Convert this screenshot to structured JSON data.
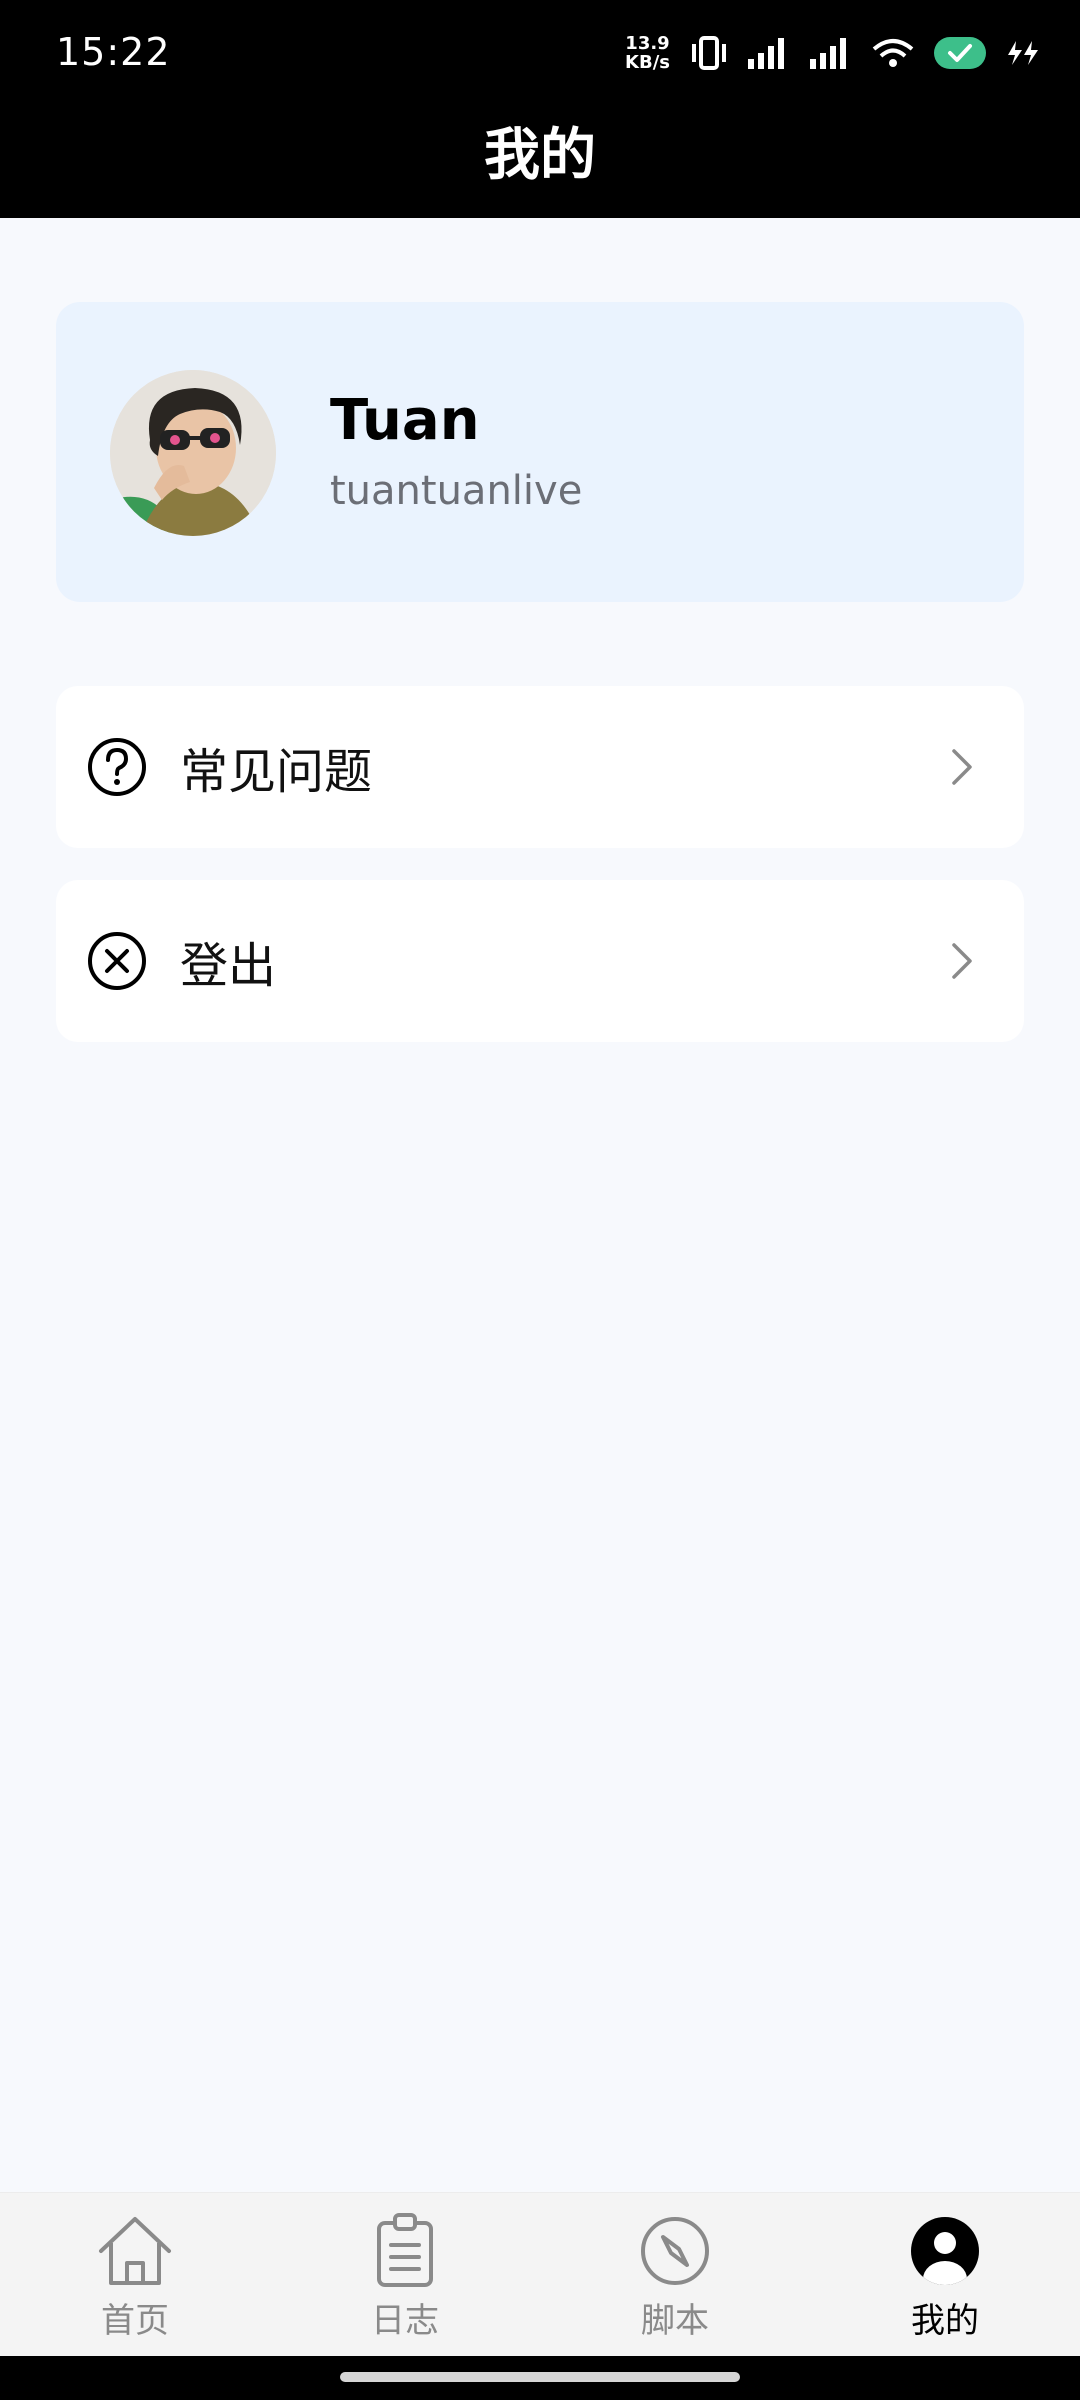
{
  "status_bar": {
    "time": "15:22",
    "net_speed_value": "13.9",
    "net_speed_unit": "KB/s"
  },
  "header": {
    "title": "我的"
  },
  "profile": {
    "name": "Tuan",
    "username": "tuantuanlive"
  },
  "menu": {
    "items": [
      {
        "label": "常见问题",
        "icon": "question-circle-icon"
      },
      {
        "label": "登出",
        "icon": "close-circle-icon"
      }
    ]
  },
  "bottom_nav": {
    "items": [
      {
        "label": "首页",
        "icon": "home-icon",
        "active": false
      },
      {
        "label": "日志",
        "icon": "clipboard-icon",
        "active": false
      },
      {
        "label": "脚本",
        "icon": "compass-icon",
        "active": false
      },
      {
        "label": "我的",
        "icon": "user-icon",
        "active": true
      }
    ]
  },
  "colors": {
    "accent": "#000000",
    "profile_card_bg": "#eaf3fe",
    "page_bg": "#f7f9fd",
    "inactive_nav": "#8a8a8a",
    "battery_green": "#3dbf8a"
  }
}
